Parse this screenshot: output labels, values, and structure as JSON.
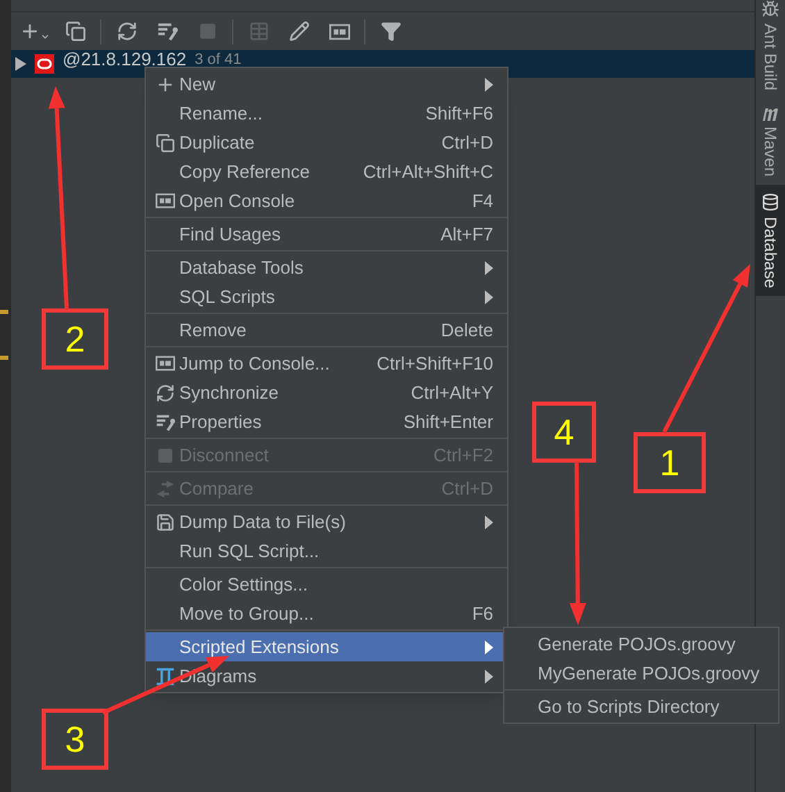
{
  "toolbar": {
    "buttons": [
      {
        "kind": "add",
        "disabled": false
      },
      {
        "kind": "duplicate",
        "disabled": false
      },
      {
        "kind": "sep"
      },
      {
        "kind": "refresh",
        "disabled": false
      },
      {
        "kind": "properties",
        "disabled": false
      },
      {
        "kind": "stop",
        "disabled": true
      },
      {
        "kind": "sep"
      },
      {
        "kind": "table",
        "disabled": true
      },
      {
        "kind": "edit",
        "disabled": false
      },
      {
        "kind": "console",
        "disabled": false
      },
      {
        "kind": "sep"
      },
      {
        "kind": "filter",
        "disabled": false
      }
    ]
  },
  "tree": {
    "items": [
      {
        "label": "@21.8.129.162",
        "detail": "3 of 41",
        "selected": true,
        "expanded": false
      }
    ]
  },
  "side_tabs": [
    {
      "label": "Ant Build",
      "selected": false
    },
    {
      "label": "Maven",
      "selected": false
    },
    {
      "label": "Database",
      "selected": true
    }
  ],
  "context_menu": {
    "items": [
      {
        "kind": "item",
        "label": "New",
        "submenu": true,
        "disabled": false,
        "selected": false
      },
      {
        "kind": "item",
        "label": "Rename...",
        "shortcut": "Shift+F6",
        "disabled": false,
        "selected": false
      },
      {
        "kind": "item",
        "label": "Duplicate",
        "shortcut": "Ctrl+D",
        "disabled": false,
        "selected": false
      },
      {
        "kind": "item",
        "label": "Copy Reference",
        "shortcut": "Ctrl+Alt+Shift+C",
        "disabled": false,
        "selected": false
      },
      {
        "kind": "item",
        "label": "Open Console",
        "shortcut": "F4",
        "disabled": false,
        "selected": false
      },
      {
        "kind": "separator"
      },
      {
        "kind": "item",
        "label": "Find Usages",
        "shortcut": "Alt+F7",
        "disabled": false,
        "selected": false
      },
      {
        "kind": "separator"
      },
      {
        "kind": "item",
        "label": "Database Tools",
        "submenu": true,
        "disabled": false,
        "selected": false
      },
      {
        "kind": "item",
        "label": "SQL Scripts",
        "submenu": true,
        "disabled": false,
        "selected": false
      },
      {
        "kind": "separator"
      },
      {
        "kind": "item",
        "label": "Remove",
        "shortcut": "Delete",
        "disabled": false,
        "selected": false
      },
      {
        "kind": "separator"
      },
      {
        "kind": "item",
        "label": "Jump to Console...",
        "shortcut": "Ctrl+Shift+F10",
        "disabled": false,
        "selected": false
      },
      {
        "kind": "item",
        "label": "Synchronize",
        "shortcut": "Ctrl+Alt+Y",
        "disabled": false,
        "selected": false
      },
      {
        "kind": "item",
        "label": "Properties",
        "shortcut": "Shift+Enter",
        "disabled": false,
        "selected": false
      },
      {
        "kind": "separator"
      },
      {
        "kind": "item",
        "label": "Disconnect",
        "shortcut": "Ctrl+F2",
        "disabled": true,
        "selected": false
      },
      {
        "kind": "separator"
      },
      {
        "kind": "item",
        "label": "Compare",
        "shortcut": "Ctrl+D",
        "disabled": true,
        "selected": false
      },
      {
        "kind": "separator"
      },
      {
        "kind": "item",
        "label": "Dump Data to File(s)",
        "submenu": true,
        "disabled": false,
        "selected": false
      },
      {
        "kind": "item",
        "label": "Run SQL Script...",
        "disabled": false,
        "selected": false
      },
      {
        "kind": "separator"
      },
      {
        "kind": "item",
        "label": "Color Settings...",
        "disabled": false,
        "selected": false
      },
      {
        "kind": "item",
        "label": "Move to Group...",
        "shortcut": "F6",
        "disabled": false,
        "selected": false
      },
      {
        "kind": "separator"
      },
      {
        "kind": "item",
        "label": "Scripted Extensions",
        "submenu": true,
        "disabled": false,
        "selected": true
      },
      {
        "kind": "item",
        "label": "Diagrams",
        "submenu": true,
        "disabled": false,
        "selected": false
      }
    ]
  },
  "submenu": {
    "items": [
      {
        "kind": "item",
        "label": "Generate POJOs.groovy"
      },
      {
        "kind": "item",
        "label": "MyGenerate POJOs.groovy"
      },
      {
        "kind": "separator"
      },
      {
        "kind": "item",
        "label": "Go to Scripts Directory"
      }
    ]
  },
  "annotations": [
    {
      "label": "2"
    },
    {
      "label": "1"
    },
    {
      "label": "4"
    },
    {
      "label": "3"
    }
  ]
}
